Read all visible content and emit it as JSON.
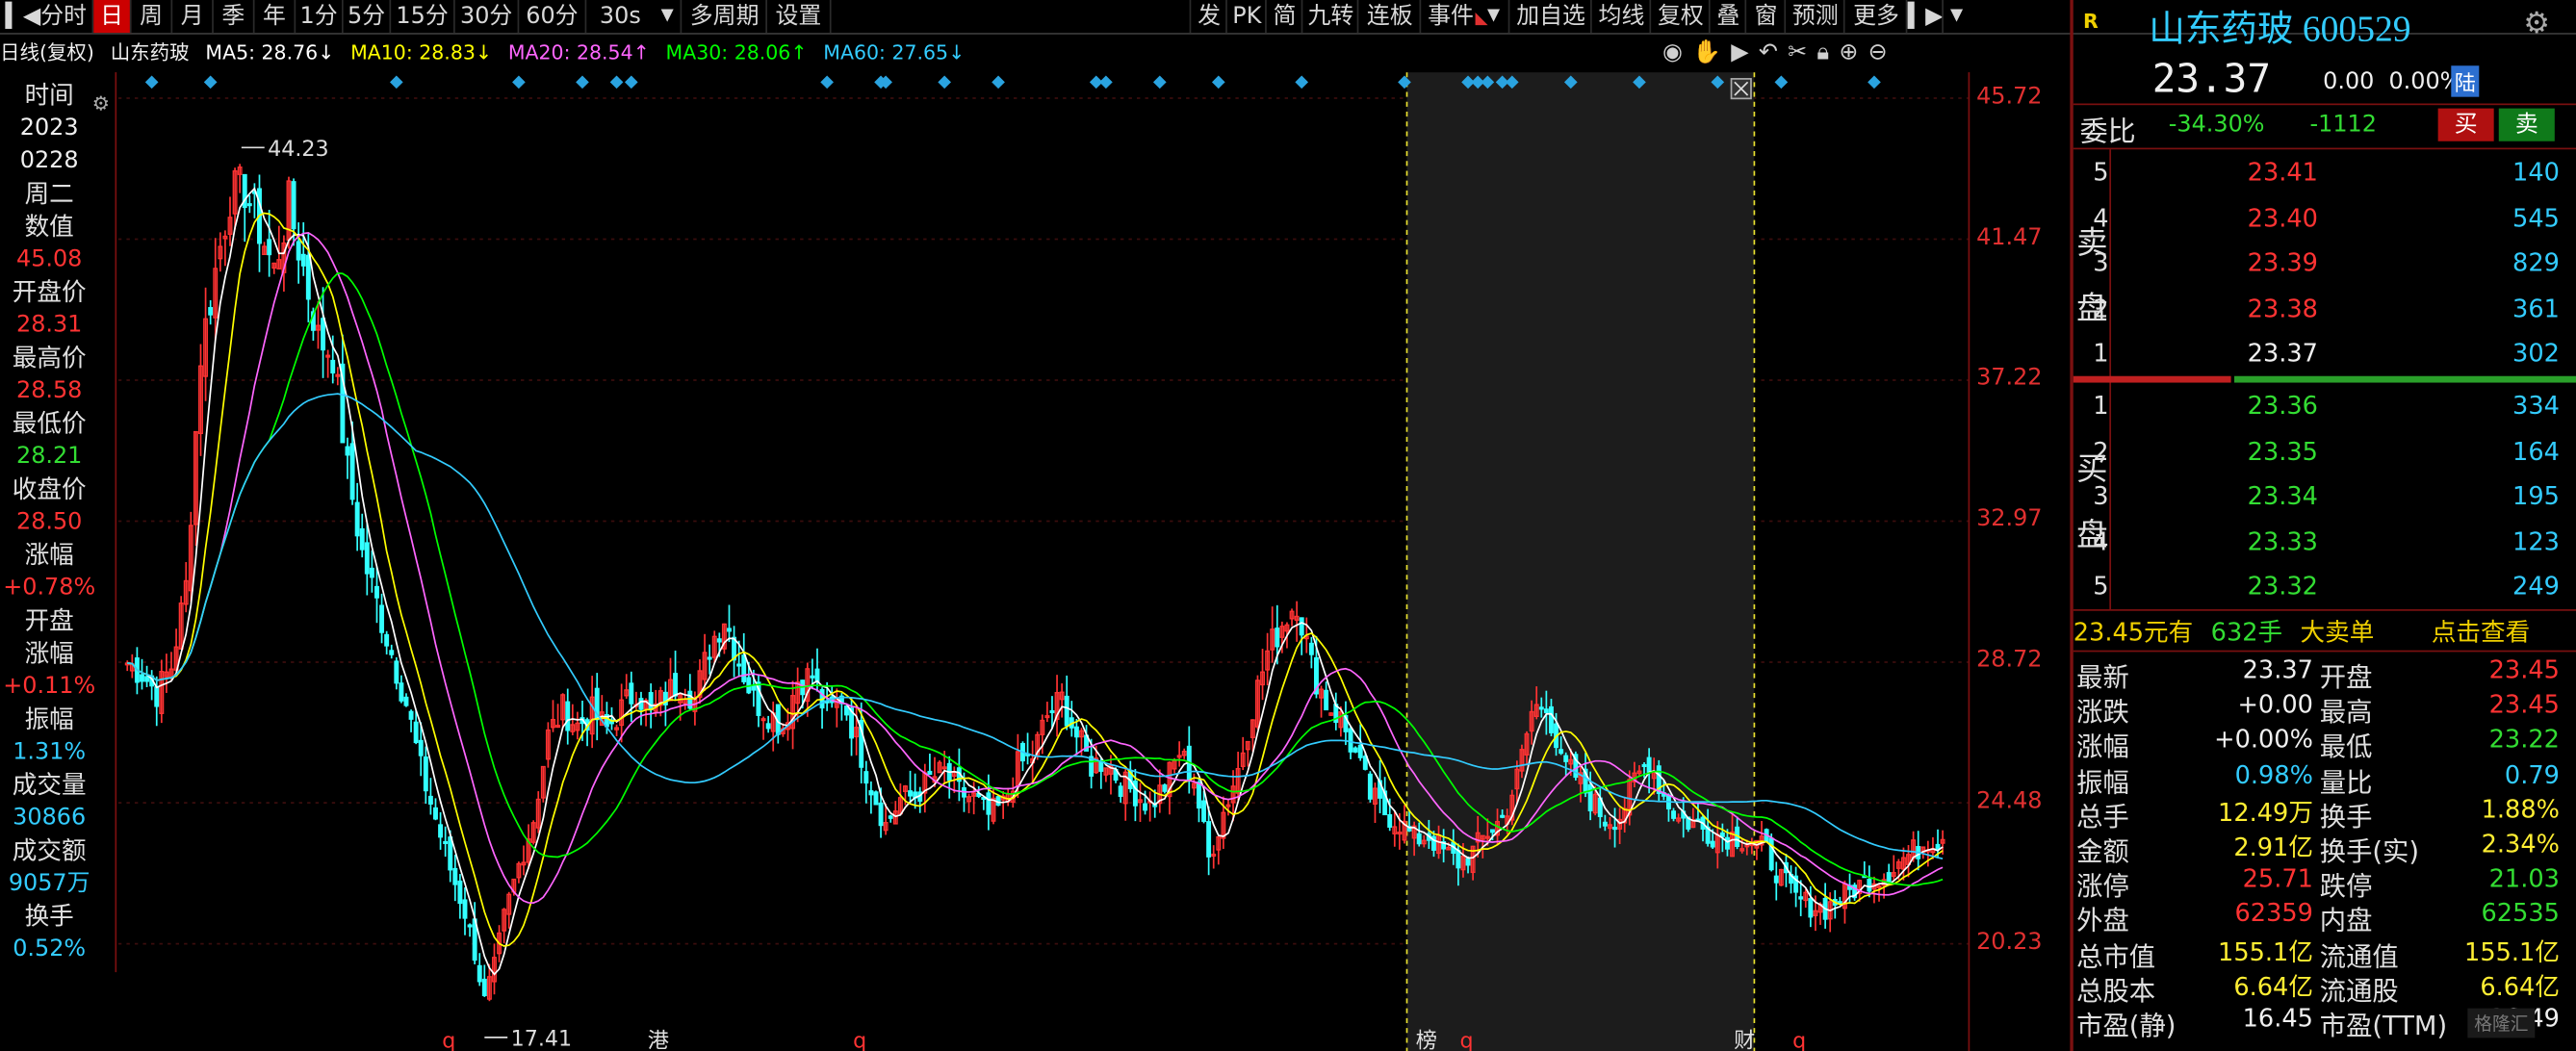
{
  "toolbar": {
    "left_items": [
      "分时",
      "日",
      "周",
      "月",
      "季",
      "年",
      "1分",
      "5分",
      "15分",
      "30分",
      "60分",
      "30s",
      "多周期",
      "设置"
    ],
    "active_item": "日",
    "right_items": [
      "发",
      "PK",
      "简",
      "九转",
      "连板",
      "事件",
      "加自选",
      "均线",
      "复权",
      "叠",
      "窗",
      "预测",
      "更多"
    ]
  },
  "indicators": {
    "period": "日线(复权)",
    "stock_name": "山东药玻",
    "ma5": "MA5: 28.76↓",
    "ma10": "MA10: 28.83↓",
    "ma20": "MA20: 28.54↑",
    "ma30": "MA30: 28.06↑",
    "ma60": "MA60: 27.65↓"
  },
  "left_info": {
    "time_label": "时间",
    "year": "2023",
    "date": "0228",
    "weekday": "周二",
    "value_label": "数值",
    "value": "45.08",
    "open_label": "开盘价",
    "open": "28.31",
    "high_label": "最高价",
    "high": "28.58",
    "low_label": "最低价",
    "low": "28.21",
    "close_label": "收盘价",
    "close": "28.50",
    "chg_label": "涨幅",
    "chg": "+0.78%",
    "open_chg_label1": "开盘",
    "open_chg_label2": "涨幅",
    "open_chg": "+0.11%",
    "amp_label": "振幅",
    "amp": "1.31%",
    "vol_label": "成交量",
    "vol": "30866",
    "amount_label": "成交额",
    "amount": "9057万",
    "turnover_label": "换手",
    "turnover": "0.52%"
  },
  "price_axis": {
    "ticks": [
      "45.72",
      "41.47",
      "37.22",
      "32.97",
      "28.72",
      "24.48",
      "20.23"
    ]
  },
  "chart_labels": {
    "high_mark": "44.23",
    "low_mark": "17.41",
    "bottom_marks": [
      "q",
      "港",
      "q",
      "榜",
      "q",
      "财",
      "q"
    ]
  },
  "quote": {
    "badge": "R",
    "name": "山东药玻",
    "code": "600529",
    "price": "23.37",
    "change": "0.00",
    "change_pct": "0.00%",
    "market": "陆",
    "weibi_label": "委比",
    "weibi": "-34.30%",
    "weicha": "-1112",
    "buy_btn": "买",
    "sell_btn": "卖",
    "sell_side_label": [
      "卖",
      "盘"
    ],
    "buy_side_label": [
      "买",
      "盘"
    ],
    "asks": [
      {
        "level": "5",
        "price": "23.41",
        "vol": "140"
      },
      {
        "level": "4",
        "price": "23.40",
        "vol": "545"
      },
      {
        "level": "3",
        "price": "23.39",
        "vol": "829"
      },
      {
        "level": "2",
        "price": "23.38",
        "vol": "361"
      },
      {
        "level": "1",
        "price": "23.37",
        "vol": "302"
      }
    ],
    "bids": [
      {
        "level": "1",
        "price": "23.36",
        "vol": "334"
      },
      {
        "level": "2",
        "price": "23.35",
        "vol": "164"
      },
      {
        "level": "3",
        "price": "23.34",
        "vol": "195"
      },
      {
        "level": "4",
        "price": "23.33",
        "vol": "123"
      },
      {
        "level": "5",
        "price": "23.32",
        "vol": "249"
      }
    ],
    "bigorder": {
      "price_text": "23.45元有",
      "qty": "632手",
      "type": "大卖单",
      "link": "点击查看"
    },
    "stats": [
      {
        "l": "最新",
        "v": "23.37",
        "vc": "white",
        "l2": "开盘",
        "v2": "23.45",
        "v2c": "red"
      },
      {
        "l": "涨跌",
        "v": "+0.00",
        "vc": "white",
        "l2": "最高",
        "v2": "23.45",
        "v2c": "red"
      },
      {
        "l": "涨幅",
        "v": "+0.00%",
        "vc": "white",
        "l2": "最低",
        "v2": "23.22",
        "v2c": "green"
      },
      {
        "l": "振幅",
        "v": "0.98%",
        "vc": "cyan",
        "l2": "量比",
        "v2": "0.79",
        "v2c": "cyan"
      },
      {
        "l": "总手",
        "v": "12.49万",
        "vc": "yellow",
        "l2": "换手",
        "v2": "1.88%",
        "v2c": "yellow"
      },
      {
        "l": "金额",
        "v": "2.91亿",
        "vc": "yellow",
        "l2": "换手(实)",
        "v2": "2.34%",
        "v2c": "yellow"
      },
      {
        "l": "涨停",
        "v": "25.71",
        "vc": "red",
        "l2": "跌停",
        "v2": "21.03",
        "v2c": "green"
      },
      {
        "l": "外盘",
        "v": "62359",
        "vc": "red",
        "l2": "内盘",
        "v2": "62535",
        "v2c": "green"
      },
      {
        "l": "总市值",
        "v": "155.1亿",
        "vc": "yellow",
        "l2": "流通值",
        "v2": "155.1亿",
        "v2c": "yellow"
      },
      {
        "l": "总股本",
        "v": "6.64亿",
        "vc": "yellow",
        "l2": "流通股",
        "v2": "6.64亿",
        "v2c": "yellow"
      },
      {
        "l": "市盈(静)",
        "v": "16.45",
        "vc": "white",
        "l2": "市盈(TTM)",
        "v2": "16.49",
        "v2c": "white"
      }
    ]
  },
  "colors": {
    "up": "#ff3333",
    "down": "#33ffff",
    "ma5": "#ffffff",
    "ma10": "#ffff00",
    "ma20": "#ff66ff",
    "ma30": "#00ff00",
    "ma60": "#33ccff",
    "frame": "#7a1010"
  },
  "chart_data": {
    "type": "candlestick",
    "ylim": [
      17.0,
      46.5
    ],
    "title": "",
    "xlabel": "",
    "ylabel": "",
    "close_series_anchor": [
      [
        0,
        28.7
      ],
      [
        3,
        28.4
      ],
      [
        6,
        27.8
      ],
      [
        9,
        28.6
      ],
      [
        12,
        31.0
      ],
      [
        15,
        38.0
      ],
      [
        18,
        40.5
      ],
      [
        21,
        42.8
      ],
      [
        24,
        43.0
      ],
      [
        27,
        41.8
      ],
      [
        30,
        40.5
      ],
      [
        33,
        42.5
      ],
      [
        36,
        40.6
      ],
      [
        39,
        38.5
      ],
      [
        42,
        38.0
      ],
      [
        45,
        34.5
      ],
      [
        48,
        32.0
      ],
      [
        51,
        30.5
      ],
      [
        54,
        29.0
      ],
      [
        57,
        27.5
      ],
      [
        60,
        25.5
      ],
      [
        63,
        24.0
      ],
      [
        66,
        22.5
      ],
      [
        69,
        21.2
      ],
      [
        71,
        20.0
      ],
      [
        73,
        18.5
      ],
      [
        75,
        19.5
      ],
      [
        77,
        21.0
      ],
      [
        80,
        22.6
      ],
      [
        83,
        24.0
      ],
      [
        86,
        26.5
      ],
      [
        89,
        27.3
      ],
      [
        92,
        26.8
      ],
      [
        95,
        27.2
      ],
      [
        98,
        26.7
      ],
      [
        101,
        27.3
      ],
      [
        104,
        27.9
      ],
      [
        107,
        27.1
      ],
      [
        110,
        27.7
      ],
      [
        113,
        28.2
      ],
      [
        116,
        27.6
      ],
      [
        119,
        29.2
      ],
      [
        122,
        30.1
      ],
      [
        125,
        28.8
      ],
      [
        128,
        27.6
      ],
      [
        131,
        27.2
      ],
      [
        134,
        26.8
      ],
      [
        137,
        28.2
      ],
      [
        140,
        28.3
      ],
      [
        143,
        27.1
      ],
      [
        146,
        27.7
      ],
      [
        149,
        26.4
      ],
      [
        152,
        25.0
      ],
      [
        155,
        23.8
      ],
      [
        158,
        24.6
      ],
      [
        161,
        24.7
      ],
      [
        164,
        25.2
      ],
      [
        167,
        25.4
      ],
      [
        170,
        24.8
      ],
      [
        173,
        24.6
      ],
      [
        176,
        24.1
      ],
      [
        179,
        24.4
      ],
      [
        182,
        25.6
      ],
      [
        185,
        25.9
      ],
      [
        188,
        27.1
      ],
      [
        191,
        27.6
      ],
      [
        194,
        26.5
      ],
      [
        197,
        25.6
      ],
      [
        200,
        25.8
      ],
      [
        203,
        25.1
      ],
      [
        206,
        24.8
      ],
      [
        209,
        24.4
      ],
      [
        212,
        25.0
      ],
      [
        215,
        26.0
      ],
      [
        218,
        25.2
      ],
      [
        221,
        22.8
      ],
      [
        224,
        24.2
      ],
      [
        227,
        25.5
      ],
      [
        230,
        27.4
      ],
      [
        233,
        29.0
      ],
      [
        236,
        29.9
      ],
      [
        239,
        30.6
      ],
      [
        242,
        28.6
      ],
      [
        245,
        27.5
      ],
      [
        248,
        27.0
      ],
      [
        251,
        25.9
      ],
      [
        254,
        24.7
      ],
      [
        257,
        24.2
      ],
      [
        260,
        23.9
      ],
      [
        263,
        23.4
      ],
      [
        266,
        23.5
      ],
      [
        269,
        23.0
      ],
      [
        272,
        22.7
      ],
      [
        275,
        23.0
      ],
      [
        278,
        23.6
      ],
      [
        281,
        24.0
      ],
      [
        284,
        25.2
      ],
      [
        287,
        27.2
      ],
      [
        290,
        27.6
      ],
      [
        293,
        25.6
      ],
      [
        296,
        25.3
      ],
      [
        299,
        24.6
      ],
      [
        302,
        24.0
      ],
      [
        305,
        24.1
      ],
      [
        308,
        25.1
      ],
      [
        311,
        25.8
      ],
      [
        314,
        24.7
      ],
      [
        317,
        24.0
      ],
      [
        320,
        23.9
      ],
      [
        323,
        23.6
      ],
      [
        326,
        23.5
      ],
      [
        329,
        23.5
      ],
      [
        332,
        23.3
      ],
      [
        335,
        23.0
      ],
      [
        338,
        22.2
      ],
      [
        341,
        21.6
      ],
      [
        344,
        21.4
      ],
      [
        347,
        21.3
      ],
      [
        350,
        21.6
      ],
      [
        353,
        21.9
      ],
      [
        356,
        22.2
      ],
      [
        359,
        22.3
      ],
      [
        362,
        22.7
      ],
      [
        365,
        23.0
      ],
      [
        368,
        23.4
      ],
      [
        371,
        23.37
      ]
    ],
    "annotations": [
      {
        "label": "44.23",
        "type": "high"
      },
      {
        "label": "17.41",
        "type": "low"
      }
    ],
    "highlight_range_index": [
      262,
      332
    ]
  }
}
